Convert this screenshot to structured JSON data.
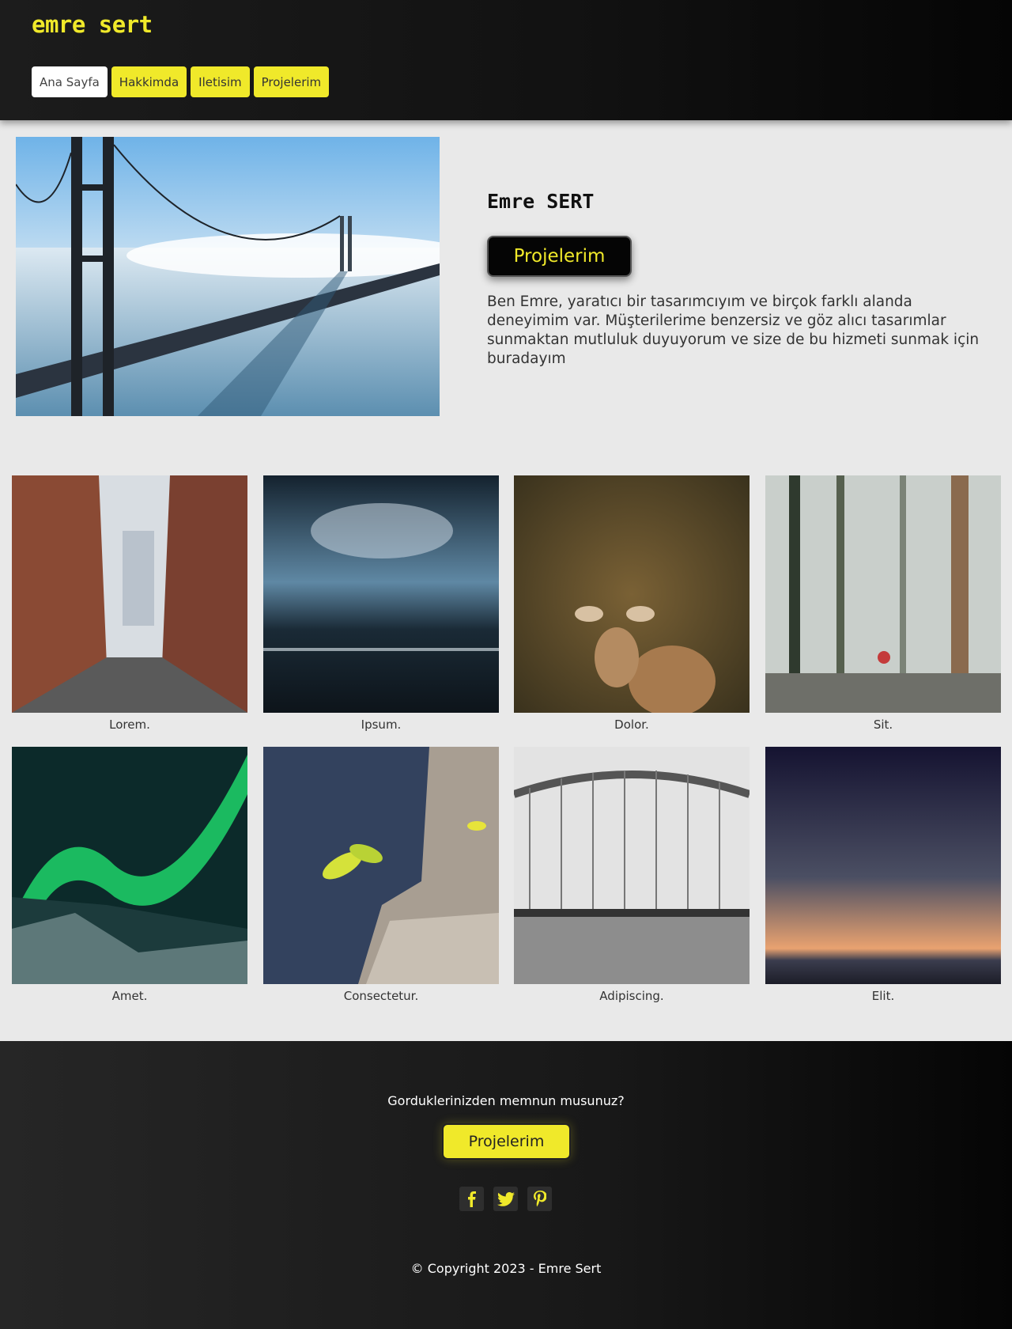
{
  "header": {
    "logo": "emre sert",
    "nav": [
      {
        "label": "Ana Sayfa",
        "active": true
      },
      {
        "label": "Hakkimda",
        "active": false
      },
      {
        "label": "Iletisim",
        "active": false
      },
      {
        "label": "Projelerim",
        "active": false
      }
    ]
  },
  "hero": {
    "title": "Emre SERT",
    "button_label": "Projelerim",
    "text": "Ben Emre, yaratıcı bir tasarımcıyım ve birçok farklı alanda deneyimim var. Müşterilerime benzersiz ve göz alıcı tasarımlar sunmaktan mutluluk duyuyorum ve size de bu hizmeti sunmak için buradayım"
  },
  "gallery": [
    {
      "caption": "Lorem."
    },
    {
      "caption": "Ipsum."
    },
    {
      "caption": "Dolor."
    },
    {
      "caption": "Sit."
    },
    {
      "caption": "Amet."
    },
    {
      "caption": "Consectetur."
    },
    {
      "caption": "Adipiscing."
    },
    {
      "caption": "Elit."
    }
  ],
  "footer": {
    "question": "Gorduklerinizden memnun musunuz?",
    "button_label": "Projelerim",
    "socials": [
      "facebook-icon",
      "twitter-icon",
      "pinterest-icon"
    ],
    "copyright": "© Copyright 2023 - Emre Sert"
  },
  "colors": {
    "accent": "#f0e92a",
    "dark": "#111111",
    "background": "#e9e9e9"
  }
}
